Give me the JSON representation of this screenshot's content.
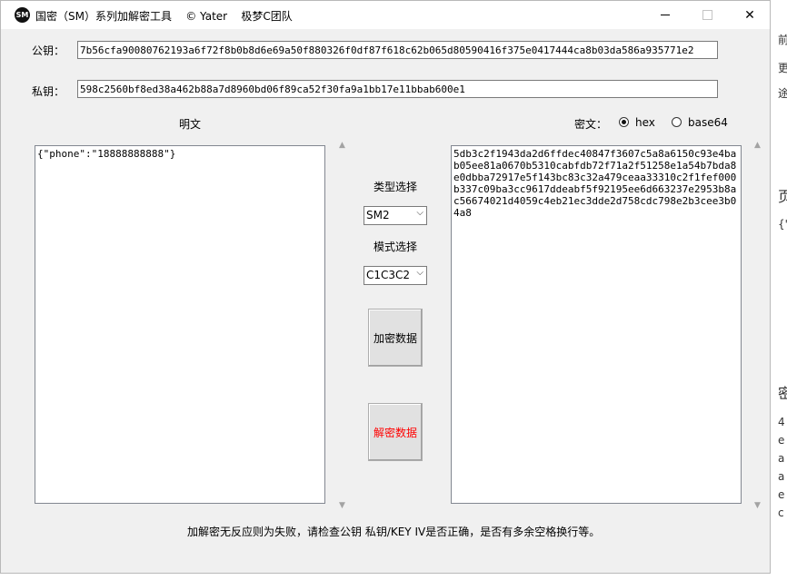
{
  "window": {
    "app_icon_text": "SM",
    "title": "国密（SM）系列加解密工具    © Yater    极梦C团队",
    "close_glyph": "✕"
  },
  "keys": {
    "public_label": "公钥：",
    "public_value": "7b56cfa90080762193a6f72f8b0b8d6e69a50f880326f0df87f618c62b065d80590416f375e0417444ca8b03da586a935771e2",
    "private_label": "私钥：",
    "private_value": "598c2560bf8ed38a462b88a7d8960bd06f89ca52f30fa9a1bb17e11bbab600e1"
  },
  "plaintext": {
    "label": "明文",
    "value": "{\"phone\":\"18888888888\"}"
  },
  "ciphertext": {
    "label": "密文：",
    "format_options": [
      "hex",
      "base64"
    ],
    "selected_format": "hex",
    "value": "5db3c2f1943da2d6ffdec40847f3607c5a8a6150c93e4bab05ee81a0670b5310cabfdb72f71a2f51258e1a54b7bda8e0dbba72917e5f143bc83c32a479ceaa33310c2f1fef000b337c09ba3cc9617ddeabf5f92195ee6d663237e2953b8ac56674021d4059c4eb21ec3dde2d758cdc798e2b3cee3b04a8"
  },
  "controls": {
    "type_label": "类型选择",
    "type_value": "SM2",
    "mode_label": "模式选择",
    "mode_value": "C1C3C2",
    "encrypt_button": "加密数据",
    "decrypt_button": "解密数据",
    "decrypt_color": "#ff0000"
  },
  "status": {
    "message": "加解密无反应则为失败，请检查公钥 私钥/KEY IV是否正确，是否有多余空格换行等。"
  },
  "background_fragments": [
    "前",
    "更",
    "途",
    "页",
    "{'",
    "密",
    "4",
    "e",
    "a",
    "a",
    "e",
    "c"
  ]
}
